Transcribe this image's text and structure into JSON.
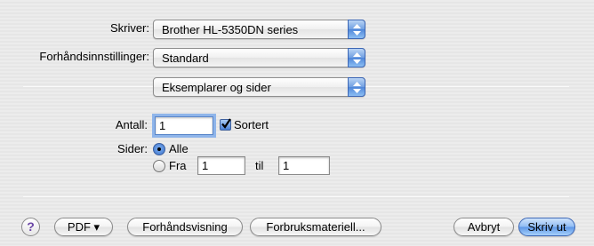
{
  "printer": {
    "label": "Skriver:",
    "value": "Brother HL-5350DN series"
  },
  "presets": {
    "label": "Forhåndsinnstillinger:",
    "value": "Standard"
  },
  "panel": {
    "value": "Eksemplarer og sider"
  },
  "copies": {
    "label": "Antall:",
    "value": "1",
    "collate_label": "Sortert",
    "collate_checked": true
  },
  "pages": {
    "label": "Sider:",
    "all_label": "Alle",
    "from_label": "Fra",
    "from_value": "1",
    "to_label": "til",
    "to_value": "1",
    "selected": "all"
  },
  "buttons": {
    "help": "?",
    "pdf": "PDF ▾",
    "preview": "Forhåndsvisning",
    "supplies": "Forbruksmateriell...",
    "cancel": "Avbryt",
    "print": "Skriv ut"
  },
  "colors": {
    "accent": "#5d96e6"
  }
}
